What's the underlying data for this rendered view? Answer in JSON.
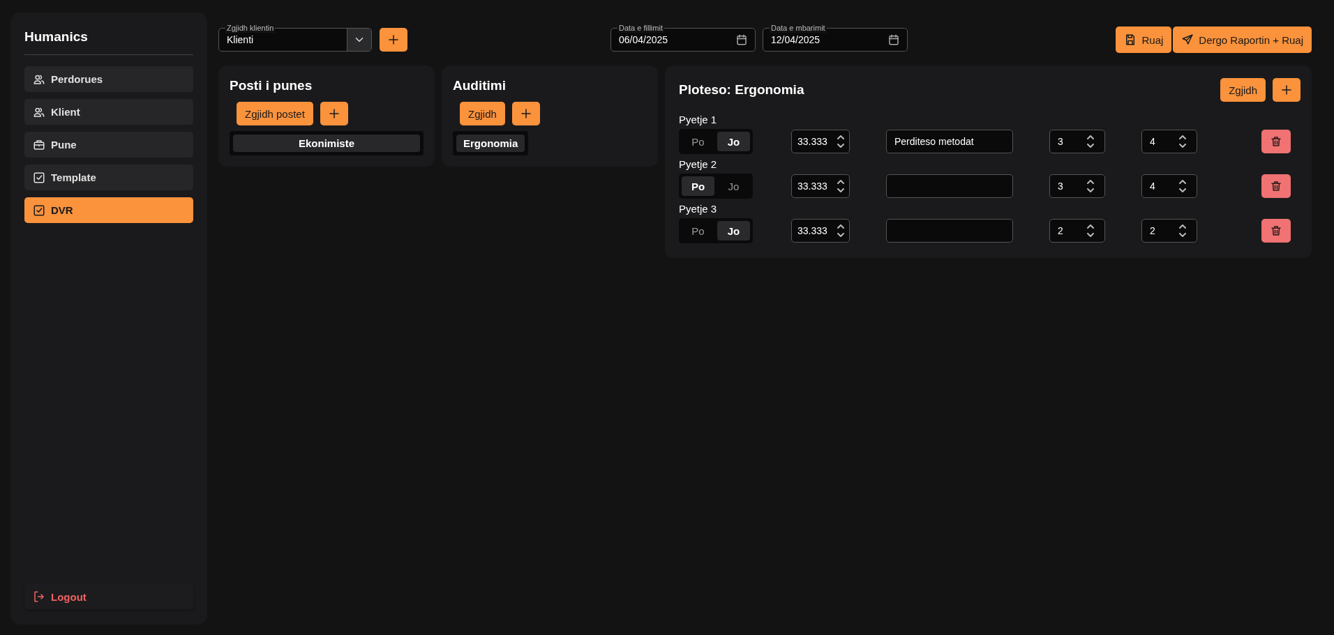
{
  "sidebar": {
    "title": "Humanics",
    "items": [
      {
        "label": "Perdorues",
        "selected": false
      },
      {
        "label": "Klient",
        "selected": false
      },
      {
        "label": "Pune",
        "selected": false
      },
      {
        "label": "Template",
        "selected": false
      },
      {
        "label": "DVR",
        "selected": true
      }
    ],
    "logout": "Logout"
  },
  "toolbar": {
    "client_select": {
      "label": "Zgjidh klientin",
      "value": "Klienti"
    },
    "start_date": {
      "label": "Data e fillimit",
      "value": "06/04/2025"
    },
    "end_date": {
      "label": "Data e mbarimit",
      "value": "12/04/2025"
    },
    "save_button": "Ruaj",
    "send_button": "Dergo Raportin + Ruaj"
  },
  "cards": [
    {
      "title": "Posti i punes",
      "select_button": "Zgjidh postet",
      "chips": [
        "Ekonimiste"
      ]
    },
    {
      "title": "Auditimi",
      "select_button": "Zgjidh",
      "chips": [
        "Ergonomia"
      ]
    }
  ],
  "form": {
    "title": "Ploteso: Ergonomia",
    "select_button": "Zgjidh",
    "questions": [
      {
        "label": "Pyetje 1",
        "options": [
          {
            "label": "Po",
            "selected": false
          },
          {
            "label": "Jo",
            "selected": true
          }
        ],
        "weight": "33.333",
        "note": "Perditeso metodat",
        "value_1": "3",
        "value_2": "4"
      },
      {
        "label": "Pyetje 2",
        "options": [
          {
            "label": "Po",
            "selected": true
          },
          {
            "label": "Jo",
            "selected": false
          }
        ],
        "weight": "33.333",
        "value_1": "3",
        "value_2": "4"
      },
      {
        "label": "Pyetje 3",
        "options": [
          {
            "label": "Po",
            "selected": false
          },
          {
            "label": "Jo",
            "selected": true
          }
        ],
        "weight": "33.333",
        "value_1": "2",
        "value_2": "2"
      }
    ]
  }
}
